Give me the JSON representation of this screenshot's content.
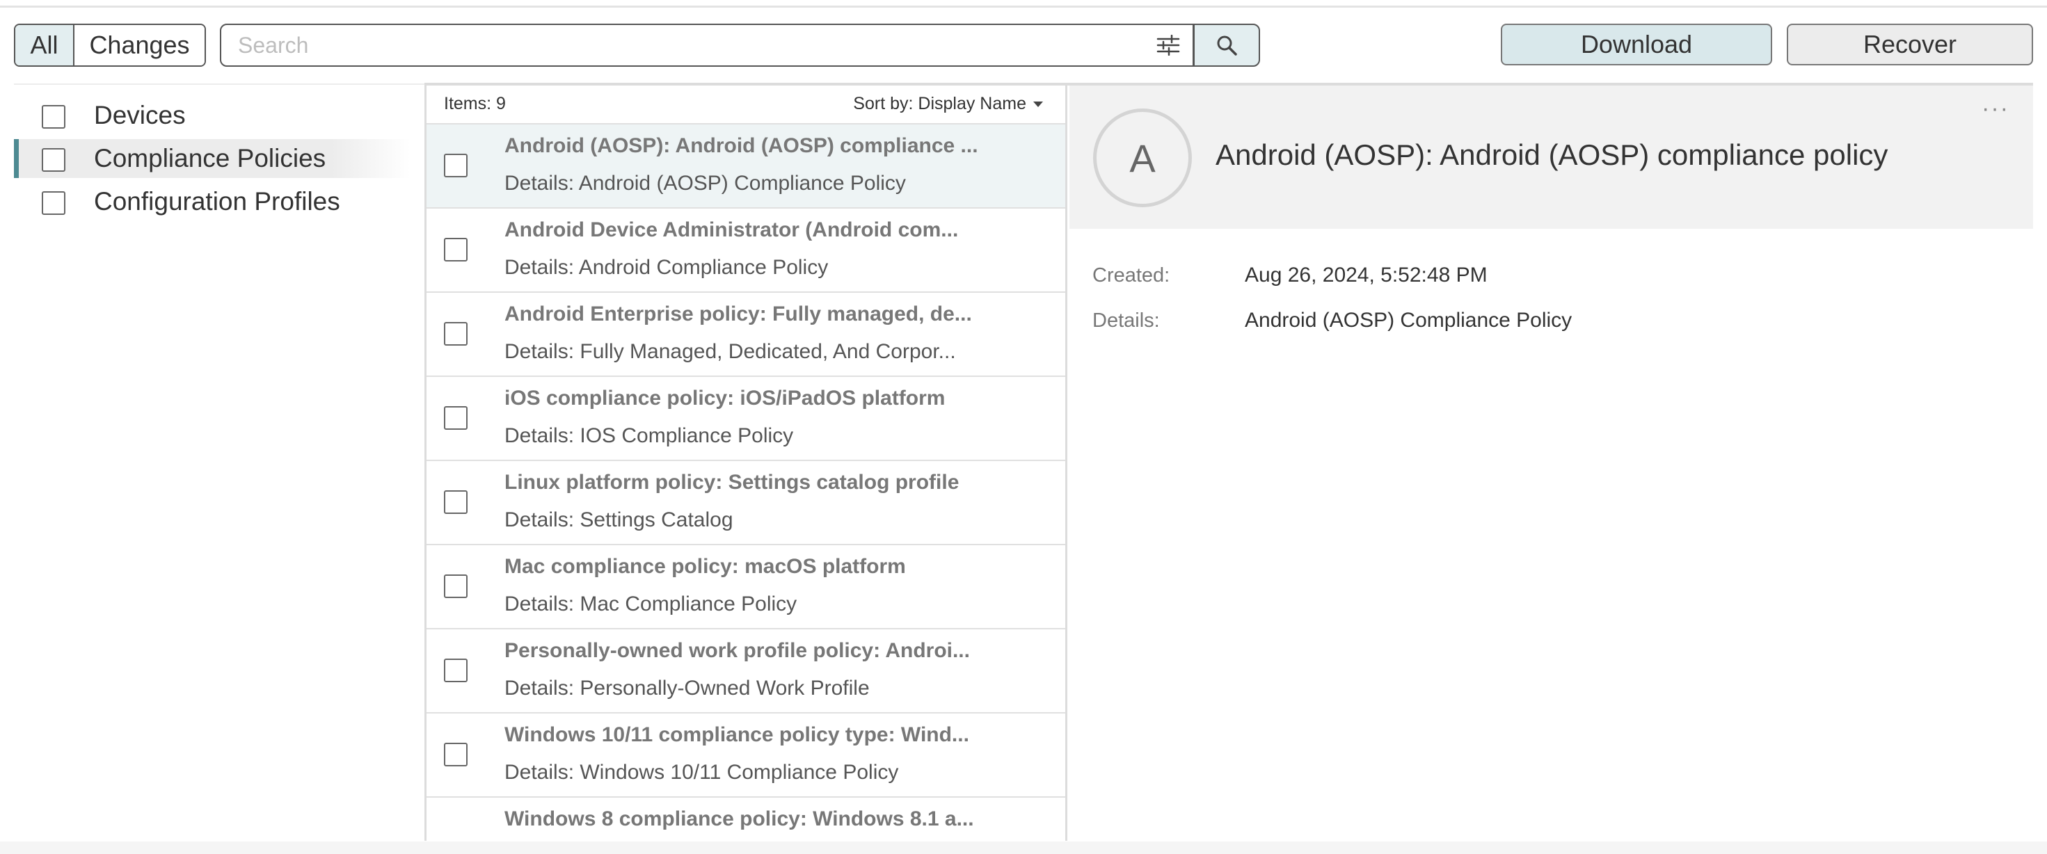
{
  "toolbar": {
    "segments": [
      {
        "label": "All",
        "selected": true
      },
      {
        "label": "Changes",
        "selected": false
      }
    ],
    "search": {
      "placeholder": "Search",
      "value": ""
    },
    "download_label": "Download",
    "recover_label": "Recover"
  },
  "sidebar": {
    "items": [
      {
        "label": "Devices",
        "active": false
      },
      {
        "label": "Compliance Policies",
        "active": true
      },
      {
        "label": "Configuration Profiles",
        "active": false
      }
    ]
  },
  "list": {
    "items_count": "Items: 9",
    "sort_label": "Sort by: Display Name",
    "rows": [
      {
        "title": "Android (AOSP): Android (AOSP) compliance ...",
        "details": "Details: Android (AOSP) Compliance Policy",
        "selected": true
      },
      {
        "title": "Android Device Administrator (Android com...",
        "details": "Details: Android Compliance Policy",
        "selected": false
      },
      {
        "title": "Android Enterprise policy: Fully managed, de...",
        "details": "Details: Fully Managed, Dedicated, And Corpor...",
        "selected": false
      },
      {
        "title": "iOS compliance policy: iOS/iPadOS platform",
        "details": "Details: IOS Compliance Policy",
        "selected": false
      },
      {
        "title": "Linux platform policy: Settings catalog profile",
        "details": "Details: Settings Catalog",
        "selected": false
      },
      {
        "title": "Mac compliance policy: macOS platform",
        "details": "Details: Mac Compliance Policy",
        "selected": false
      },
      {
        "title": "Personally-owned work profile policy: Androi...",
        "details": "Details: Personally-Owned Work Profile",
        "selected": false
      },
      {
        "title": "Windows 10/11 compliance policy type: Wind...",
        "details": "Details: Windows 10/11 Compliance Policy",
        "selected": false
      },
      {
        "title": "Windows 8 compliance policy: Windows 8.1 a...",
        "details": "",
        "selected": false
      }
    ]
  },
  "detail": {
    "avatar_letter": "A",
    "title": "Android (AOSP): Android (AOSP) compliance policy",
    "more_label": "···",
    "created_label": "Created:",
    "created_value": "Aug 26, 2024, 5:52:48 PM",
    "details_label": "Details:",
    "details_value": "Android (AOSP) Compliance Policy"
  },
  "icons": {
    "filter": "sliders-icon",
    "search": "magnifier-icon",
    "more": "ellipsis-icon"
  }
}
